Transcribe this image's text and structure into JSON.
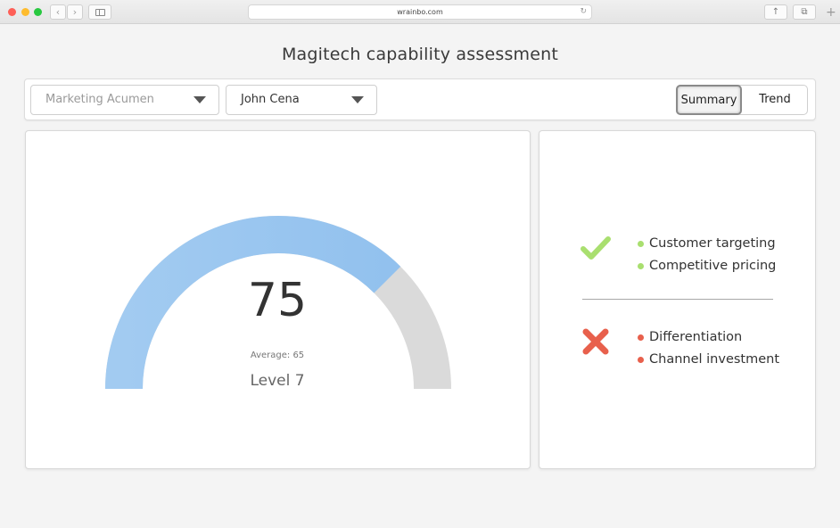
{
  "browser": {
    "url": "wrainbo.com"
  },
  "page": {
    "title": "Magitech capability assessment"
  },
  "filters": {
    "category": {
      "value": "Marketing Acumen"
    },
    "person": {
      "value": "John Cena"
    }
  },
  "view_toggle": {
    "options": [
      "Summary",
      "Trend"
    ],
    "selected": "Summary"
  },
  "gauge": {
    "value": "75",
    "value_numeric": 75,
    "max": 100,
    "average_label": "Average: 65",
    "level_label": "Level 7",
    "fill_color": "#92c1ee",
    "track_color": "#dadada"
  },
  "assessment": {
    "strengths": {
      "icon": "checkmark-icon",
      "color": "#a9df6f",
      "items": [
        "Customer targeting",
        "Competitive pricing"
      ]
    },
    "weaknesses": {
      "icon": "cross-icon",
      "color": "#e8604c",
      "items": [
        "Differentiation",
        "Channel investment"
      ]
    }
  }
}
